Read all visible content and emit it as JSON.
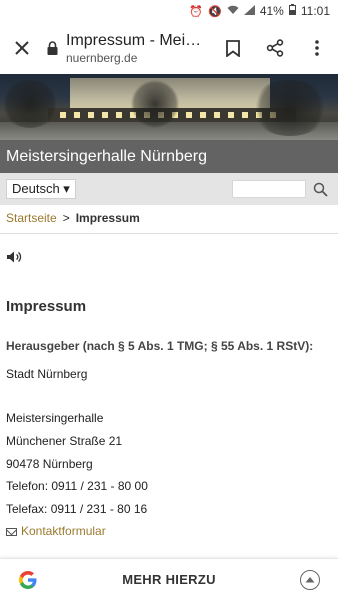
{
  "status_bar": {
    "battery": "41%",
    "time": "11:01"
  },
  "browser": {
    "tab_title": "Impressum - Meis...",
    "domain": "nuernberg.de"
  },
  "site": {
    "title": "Meistersingerhalle Nürnberg"
  },
  "toolbar": {
    "language": "Deutsch ▾",
    "search_placeholder": ""
  },
  "breadcrumb": {
    "home": "Startseite",
    "separator": ">",
    "current": "Impressum"
  },
  "content": {
    "heading": "Impressum",
    "publisher_heading": "Herausgeber (nach § 5 Abs. 1 TMG; § 55 Abs. 1 RStV):",
    "publisher": "Stadt Nürnberg",
    "address_lines": [
      "Meistersingerhalle",
      "Münchener Straße 21",
      "90478 Nürnberg",
      "Telefon: 0911 / 231 - 80 00",
      "Telefax: 0911 / 231 - 80 16"
    ],
    "contact_link": "Kontaktformular"
  },
  "bottom": {
    "more_label": "MEHR HIERZU"
  },
  "colors": {
    "link": "#9b7a2e",
    "title_bar": "#636363",
    "toolbar": "#e4e4e4"
  }
}
